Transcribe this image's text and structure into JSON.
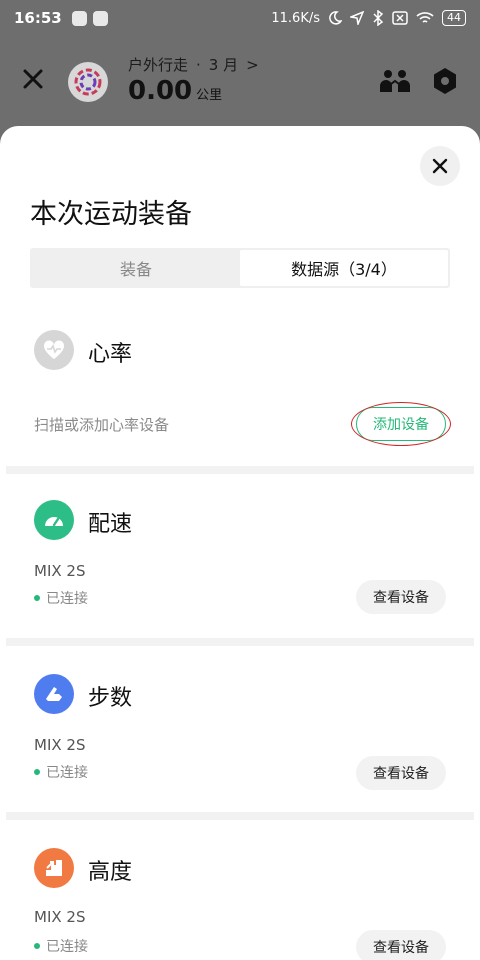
{
  "status_bar": {
    "time": "16:53",
    "network_speed": "11.6K/s",
    "battery": "44"
  },
  "header": {
    "activity": "户外行走",
    "separator": "·",
    "month": "3 月",
    "chevron": ">",
    "distance_value": "0.00",
    "distance_unit": "公里"
  },
  "sheet": {
    "title": "本次运动装备",
    "tabs": [
      {
        "label": "装备",
        "active": false
      },
      {
        "label": "数据源（3/4）",
        "active": true
      }
    ],
    "sensors": [
      {
        "title": "心率",
        "hint": "扫描或添加心率设备",
        "button": "添加设备"
      },
      {
        "title": "配速",
        "device": "MIX 2S",
        "status": "已连接",
        "button": "查看设备"
      },
      {
        "title": "步数",
        "device": "MIX 2S",
        "status": "已连接",
        "button": "查看设备"
      },
      {
        "title": "高度",
        "device": "MIX 2S",
        "status": "已连接",
        "button": "查看设备"
      }
    ]
  },
  "colors": {
    "accent_green": "#25b87a",
    "pace_icon": "#2dbd86",
    "steps_icon": "#4f7df0",
    "altitude_icon": "#f07a41",
    "heart_icon": "#d6d6d6",
    "annotation_red": "#d0262a"
  },
  "icons": {
    "close": "close-icon",
    "avatar": "activity-logo-icon",
    "group": "group-icon",
    "settings": "hexagon-settings-icon",
    "heart": "heart-rate-icon",
    "pace": "speedometer-icon",
    "steps": "shoe-icon",
    "altitude": "stairs-icon"
  }
}
